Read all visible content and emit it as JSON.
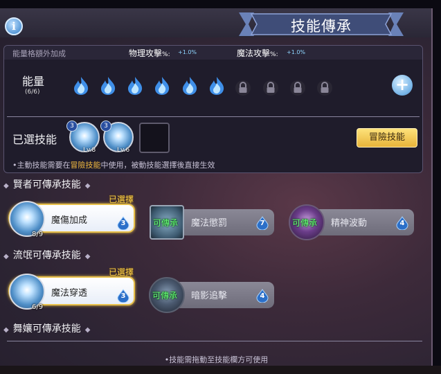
{
  "header": {
    "title": "技能傳承",
    "info_icon": "i"
  },
  "top_panel": {
    "stats": {
      "extra_bonus_label": "能量格額外加成",
      "physical_label": "物理攻擊",
      "physical_unit": "%:",
      "physical_value": "+1.0%",
      "magic_label": "魔法攻擊",
      "magic_unit": "%:",
      "magic_value": "+1.0%"
    },
    "energy": {
      "label": "能量",
      "count": "(6/6)",
      "filled_slots": 6,
      "locked_slots": 4,
      "add_icon": "+"
    },
    "selected_skills": {
      "label": "已選技能",
      "skills": [
        {
          "badge": "3",
          "level": "Lv.8"
        },
        {
          "badge": "3",
          "level": "Lv.6"
        }
      ],
      "adventure_button": "冒險技能"
    },
    "note_prefix": "•主動技能需要在",
    "note_highlight": "冒險技能",
    "note_suffix": "中使用，被動技能選擇後直接生效"
  },
  "sections": [
    {
      "title": "賢者可傳承技能",
      "cards": [
        {
          "name": "魔傷加成",
          "state": "selected",
          "tag": "已選擇",
          "progress": "8/9",
          "cost": "3"
        },
        {
          "name": "魔法懲罰",
          "state": "available",
          "tag": "可傳承",
          "cost": "7"
        },
        {
          "name": "精神波動",
          "state": "available",
          "tag": "可傳承",
          "cost": "4"
        }
      ]
    },
    {
      "title": "流氓可傳承技能",
      "cards": [
        {
          "name": "魔法穿透",
          "state": "selected",
          "tag": "已選擇",
          "progress": "6/9",
          "cost": "3"
        },
        {
          "name": "暗影追擊",
          "state": "available",
          "tag": "可傳承",
          "cost": "4"
        }
      ]
    },
    {
      "title": "舞孃可傳承技能",
      "cards": []
    }
  ],
  "footer_note": "•技能需拖動至技能欄方可使用",
  "colors": {
    "selected_border": "#e8c04a",
    "available_tag": "#6aff7a",
    "selected_tag": "#ffd24a",
    "accent_blue": "#4f8fc8"
  }
}
